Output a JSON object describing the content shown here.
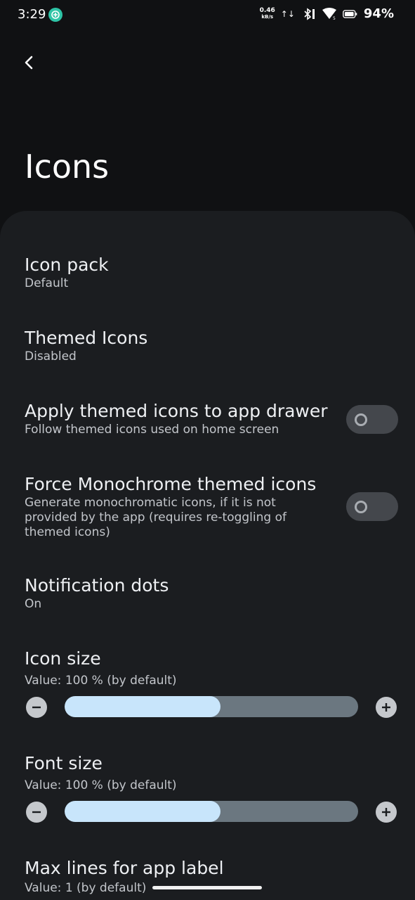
{
  "status_bar": {
    "time": "3:29",
    "net_speed": "0.46",
    "net_unit": "kB/s",
    "battery": "94%"
  },
  "header": {
    "title": "Icons"
  },
  "settings": {
    "icon_pack": {
      "title": "Icon pack",
      "value": "Default"
    },
    "themed_icons": {
      "title": "Themed Icons",
      "value": "Disabled"
    },
    "apply_drawer": {
      "title": "Apply themed icons to app drawer",
      "summary": "Follow themed icons used on home screen",
      "enabled": false
    },
    "force_mono": {
      "title": "Force Monochrome themed icons",
      "summary": "Generate monochromatic icons, if it is not provided by the app (requires re-toggling of themed icons)",
      "enabled": false
    },
    "notification_dots": {
      "title": "Notification dots",
      "value": "On"
    },
    "icon_size": {
      "title": "Icon size",
      "value": "Value: 100 % (by default)",
      "level": 0.53
    },
    "font_size": {
      "title": "Font size",
      "value": "Value: 100 % (by default)",
      "level": 0.53
    },
    "max_lines": {
      "title": "Max lines for app label",
      "value": "Value: 1  (by default)"
    }
  },
  "colors": {
    "background": "#101113",
    "sheet": "#1b1d20",
    "slider_fill": "#c8e5fb",
    "slider_track": "#6b7780",
    "toggle_off": "#44474c"
  }
}
